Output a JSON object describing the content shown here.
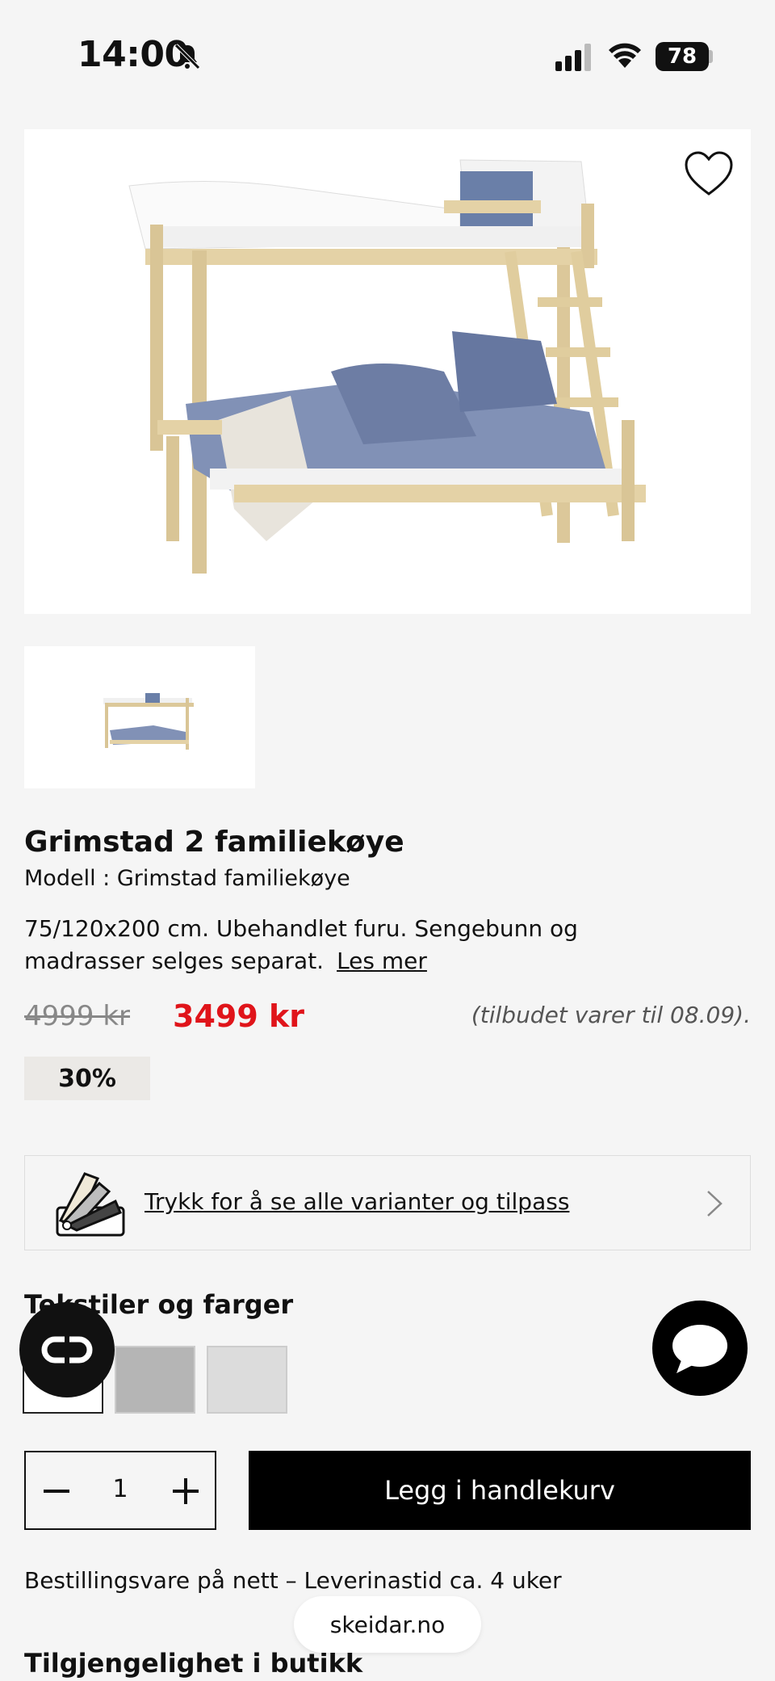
{
  "status_bar": {
    "time": "14:00",
    "battery": "78"
  },
  "product": {
    "title": "Grimstad 2 familiekøye",
    "model": "Modell : Grimstad familiekøye",
    "description": "75/120x200 cm. Ubehandlet furu. Sengebunn og madrasser selges separat.",
    "read_more": "Les mer",
    "old_price": "4999 kr",
    "new_price": "3499 kr",
    "offer_note": "(tilbudet varer til 08.09).",
    "discount": "30%"
  },
  "variants": {
    "label": "Trykk for å se alle varianter og tilpass",
    "icon": "color-fan-icon"
  },
  "textiles": {
    "title": "Tekstiler og farger",
    "swatches": [
      "#ffffff",
      "#b5b5b5",
      "#dcdcdc"
    ]
  },
  "cart": {
    "quantity": "1",
    "add_label": "Legg i handlekurv"
  },
  "delivery_text": "Bestillingsvare på nett – Leverinastid ca. 4 uker",
  "url": "skeidar.no",
  "availability_title": "Tilgjengelighet i butikk",
  "colors": {
    "sale_red": "#e0141a",
    "button_black": "#000000",
    "background": "#f5f5f5"
  }
}
